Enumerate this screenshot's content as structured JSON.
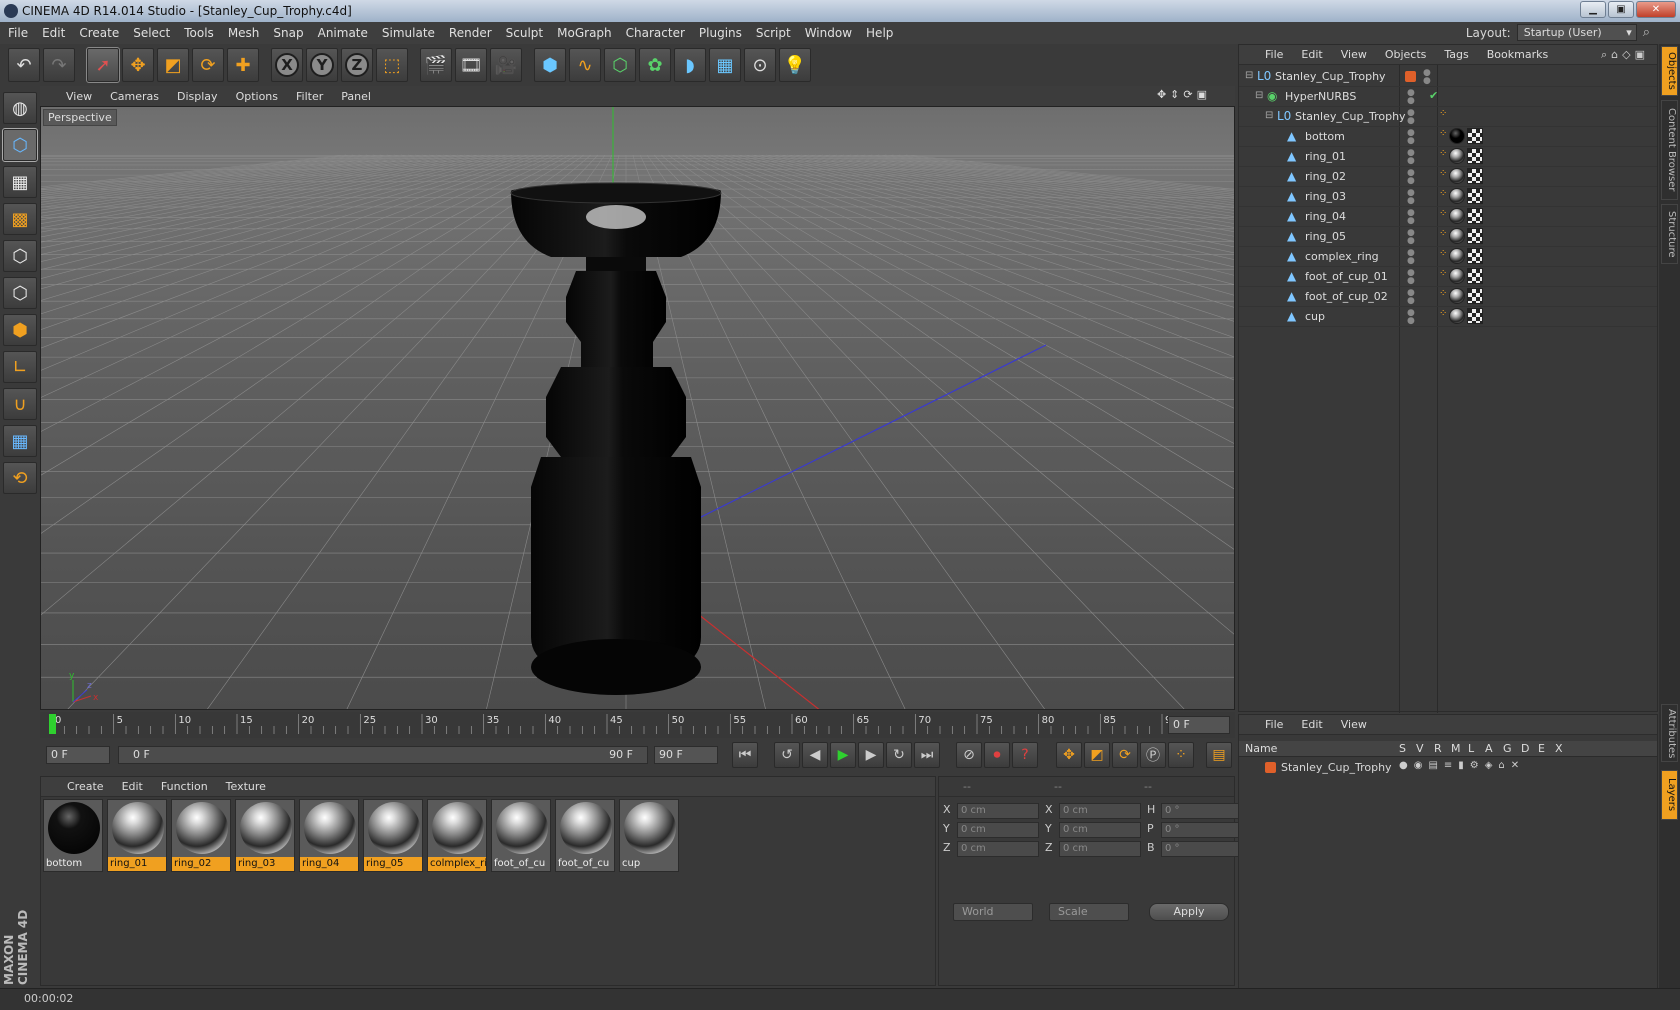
{
  "window": {
    "title": "CINEMA 4D R14.014 Studio - [Stanley_Cup_Trophy.c4d]"
  },
  "menu": [
    "File",
    "Edit",
    "Create",
    "Select",
    "Tools",
    "Mesh",
    "Snap",
    "Animate",
    "Simulate",
    "Render",
    "Sculpt",
    "MoGraph",
    "Character",
    "Plugins",
    "Script",
    "Window",
    "Help"
  ],
  "layout": {
    "label": "Layout:",
    "value": "Startup (User)"
  },
  "viewport": {
    "menu": [
      "View",
      "Cameras",
      "Display",
      "Options",
      "Filter",
      "Panel"
    ],
    "label": "Perspective"
  },
  "timeline": {
    "ticks": [
      "0",
      "5",
      "10",
      "15",
      "20",
      "25",
      "30",
      "35",
      "40",
      "45",
      "50",
      "55",
      "60",
      "65",
      "70",
      "75",
      "80",
      "85",
      "90"
    ],
    "end_field": "0 F",
    "start_field": "0 F",
    "range_start": "0 F",
    "range_end": "90 F",
    "max_field": "90 F"
  },
  "material_manager": {
    "menu": [
      "Create",
      "Edit",
      "Function",
      "Texture"
    ],
    "materials": [
      {
        "name": "bottom",
        "highlight": false,
        "kind": "black"
      },
      {
        "name": "ring_01",
        "highlight": true,
        "kind": "chrome"
      },
      {
        "name": "ring_02",
        "highlight": true,
        "kind": "chrome"
      },
      {
        "name": "ring_03",
        "highlight": true,
        "kind": "chrome"
      },
      {
        "name": "ring_04",
        "highlight": true,
        "kind": "chrome"
      },
      {
        "name": "ring_05",
        "highlight": true,
        "kind": "chrome"
      },
      {
        "name": "colmplex_ri",
        "highlight": true,
        "kind": "chrome"
      },
      {
        "name": "foot_of_cu",
        "highlight": false,
        "kind": "chrome"
      },
      {
        "name": "foot_of_cu",
        "highlight": false,
        "kind": "chrome"
      },
      {
        "name": "cup",
        "highlight": false,
        "kind": "chrome"
      }
    ]
  },
  "coordinates": {
    "headers": [
      "--",
      "--",
      "--"
    ],
    "rows": [
      {
        "a": "X",
        "av": "0 cm",
        "b": "X",
        "bv": "0 cm",
        "c": "H",
        "cv": "0 °"
      },
      {
        "a": "Y",
        "av": "0 cm",
        "b": "Y",
        "bv": "0 cm",
        "c": "P",
        "cv": "0 °"
      },
      {
        "a": "Z",
        "av": "0 cm",
        "b": "Z",
        "bv": "0 cm",
        "c": "B",
        "cv": "0 °"
      }
    ],
    "world": "World",
    "scale": "Scale",
    "apply": "Apply"
  },
  "object_manager": {
    "menu": [
      "File",
      "Edit",
      "View",
      "Objects",
      "Tags",
      "Bookmarks"
    ],
    "objects": [
      {
        "name": "Stanley_Cup_Trophy",
        "level": 0,
        "icon": "null"
      },
      {
        "name": "HyperNURBS",
        "level": 1,
        "icon": "nurbs"
      },
      {
        "name": "Stanley_Cup_Trophy",
        "level": 2,
        "icon": "null"
      },
      {
        "name": "bottom",
        "level": 3,
        "icon": "poly"
      },
      {
        "name": "ring_01",
        "level": 3,
        "icon": "poly"
      },
      {
        "name": "ring_02",
        "level": 3,
        "icon": "poly"
      },
      {
        "name": "ring_03",
        "level": 3,
        "icon": "poly"
      },
      {
        "name": "ring_04",
        "level": 3,
        "icon": "poly"
      },
      {
        "name": "ring_05",
        "level": 3,
        "icon": "poly"
      },
      {
        "name": "complex_ring",
        "level": 3,
        "icon": "poly"
      },
      {
        "name": "foot_of_cup_01",
        "level": 3,
        "icon": "poly"
      },
      {
        "name": "foot_of_cup_02",
        "level": 3,
        "icon": "poly"
      },
      {
        "name": "cup",
        "level": 3,
        "icon": "poly"
      }
    ]
  },
  "layer_manager": {
    "menu": [
      "File",
      "Edit",
      "View"
    ],
    "columns": [
      "Name",
      "S",
      "V",
      "R",
      "M",
      "L",
      "A",
      "G",
      "D",
      "E",
      "X"
    ],
    "layers": [
      {
        "name": "Stanley_Cup_Trophy"
      }
    ]
  },
  "side_tabs": [
    "Objects",
    "Content Browser",
    "Structure",
    "Attributes",
    "Layers"
  ],
  "status": {
    "time": "00:00:02"
  },
  "brand": "MAXON CINEMA 4D",
  "colors": {
    "accent": "#f0a020",
    "bg": "#3a3a3a",
    "axis_x": "#c03030",
    "axis_y": "#30c030",
    "axis_z": "#3030c0"
  }
}
